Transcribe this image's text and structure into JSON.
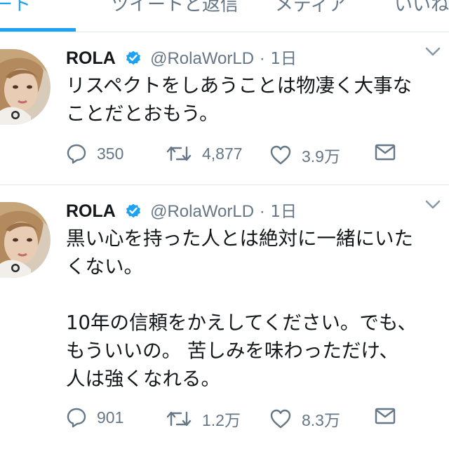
{
  "tabs": [
    {
      "label": "ート",
      "active": true
    },
    {
      "label": "ツイートと返信",
      "active": false
    },
    {
      "label": "メディア",
      "active": false
    },
    {
      "label": "いいね",
      "active": false
    }
  ],
  "colors": {
    "accent": "#1da1f2",
    "muted": "#657786",
    "text": "#14171a",
    "divider": "#e1e8ed"
  },
  "tweets": [
    {
      "name": "ROLA",
      "handle": "@RolaWorLD",
      "separator": "·",
      "time": "1日",
      "lines": [
        "リスペクトをしあうことは物凄く大事な",
        "ことだとおもう。"
      ],
      "replies": "350",
      "retweets": "4,877",
      "likes": "3.9万"
    },
    {
      "name": "ROLA",
      "handle": "@RolaWorLD",
      "separator": "·",
      "time": "1日",
      "lines": [
        "黒い心を持った人とは絶対に一緒にいた",
        "くない。",
        "",
        "10年の信頼をかえしてください。でも、",
        "もういいの。 苦しみを味わっただけ、",
        "人は強くなれる。"
      ],
      "replies": "901",
      "retweets": "1.2万",
      "likes": "8.3万"
    }
  ]
}
